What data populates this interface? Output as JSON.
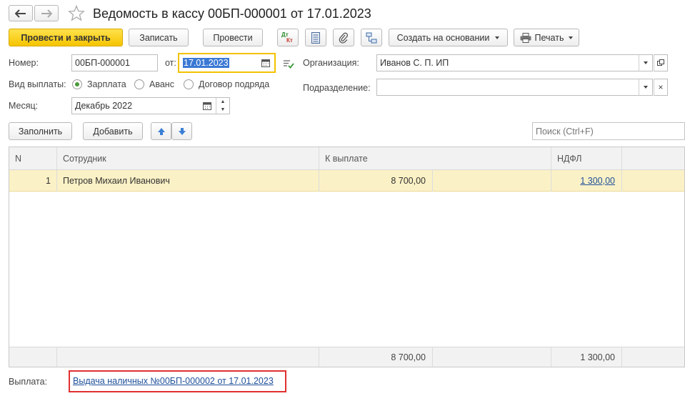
{
  "header": {
    "title": "Ведомость в кассу 00БП-000001 от 17.01.2023"
  },
  "toolbar": {
    "post_close_label": "Провести и закрыть",
    "save_label": "Записать",
    "post_label": "Провести",
    "dt_kt_top": "Дт",
    "dt_kt_bottom": "Кт",
    "create_based_label": "Создать на основании",
    "print_label": "Печать"
  },
  "form": {
    "number_label": "Номер:",
    "number_value": "00БП-000001",
    "date_label": "от:",
    "date_value": "17.01.2023",
    "org_label": "Организация:",
    "org_value": "Иванов С. П. ИП",
    "payment_type_label": "Вид выплаты:",
    "payment_types": [
      "Зарплата",
      "Аванс",
      "Договор подряда"
    ],
    "payment_type_selected": "Зарплата",
    "division_label": "Подразделение:",
    "division_value": "",
    "month_label": "Месяц:",
    "month_value": "Декабрь 2022"
  },
  "table_toolbar": {
    "fill_label": "Заполнить",
    "add_label": "Добавить",
    "search_placeholder": "Поиск (Ctrl+F)"
  },
  "table": {
    "columns": [
      "N",
      "Сотрудник",
      "К выплате",
      "НДФЛ"
    ],
    "rows": [
      {
        "n": "1",
        "employee": "Петров Михаил Иванович",
        "to_pay": "8 700,00",
        "ndfl": "1 300,00"
      }
    ],
    "totals": {
      "to_pay": "8 700,00",
      "ndfl": "1 300,00"
    }
  },
  "footer": {
    "payment_label": "Выплата:",
    "payment_link": "Выдача наличных №00БП-000002 от 17.01.2023"
  },
  "colors": {
    "primary_button": "#f5c400",
    "selected_row": "#fbf1c6",
    "link": "#1f4f9b",
    "highlight_frame": "#e03030"
  }
}
